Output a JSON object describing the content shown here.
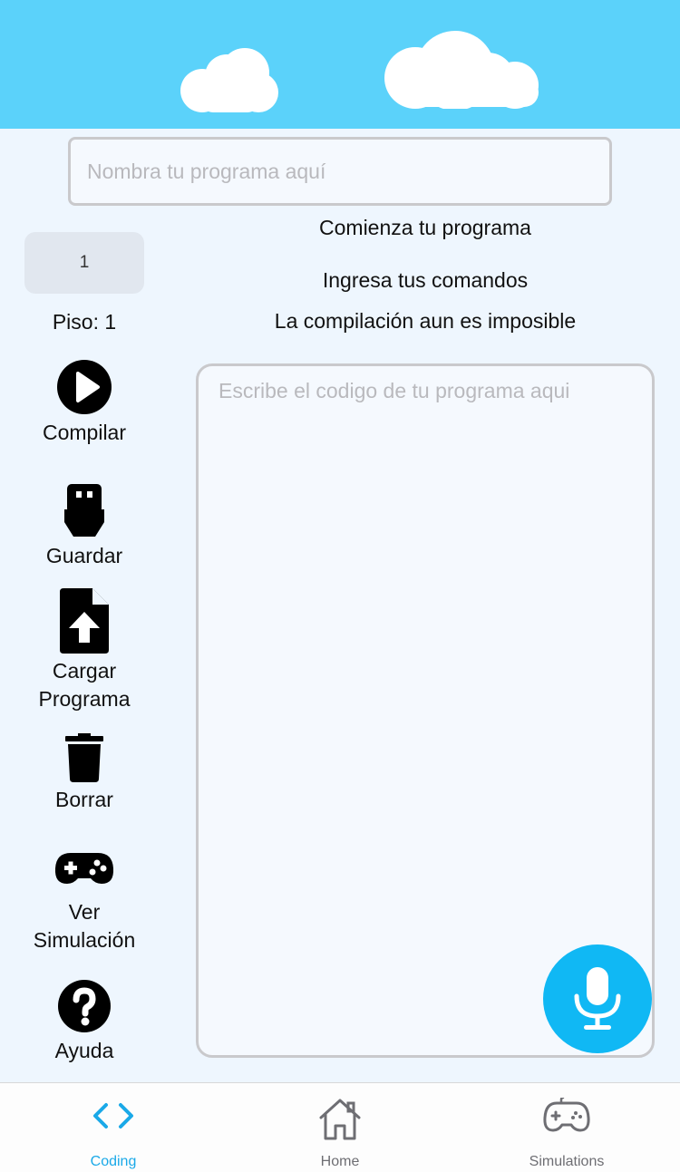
{
  "header": {
    "sky_color": "#5bd2fa"
  },
  "program_name": {
    "placeholder": "Nombra tu programa aquí",
    "value": ""
  },
  "status": {
    "line1": "Comienza tu programa",
    "line2": "Ingresa tus comandos",
    "line3": "La compilación aun es imposible"
  },
  "floor": {
    "box_value": "1",
    "label": "Piso: 1"
  },
  "sidebar": {
    "compile": "Compilar",
    "save": "Guardar",
    "load_line1": "Cargar",
    "load_line2": "Programa",
    "delete": "Borrar",
    "sim_line1": "Ver",
    "sim_line2": "Simulación",
    "help": "Ayuda"
  },
  "editor": {
    "placeholder": "Escribe el codigo de tu programa aqui",
    "value": ""
  },
  "tabs": [
    {
      "label": "Coding",
      "icon": "code-icon",
      "active": true
    },
    {
      "label": "Home",
      "icon": "home-icon",
      "active": false
    },
    {
      "label": "Simulations",
      "icon": "gamepad-icon",
      "active": false
    }
  ],
  "colors": {
    "accent": "#10b8f4",
    "active_tab": "#1aa9e8",
    "inactive_tab": "#6e6e73",
    "background": "#eef6fe"
  }
}
